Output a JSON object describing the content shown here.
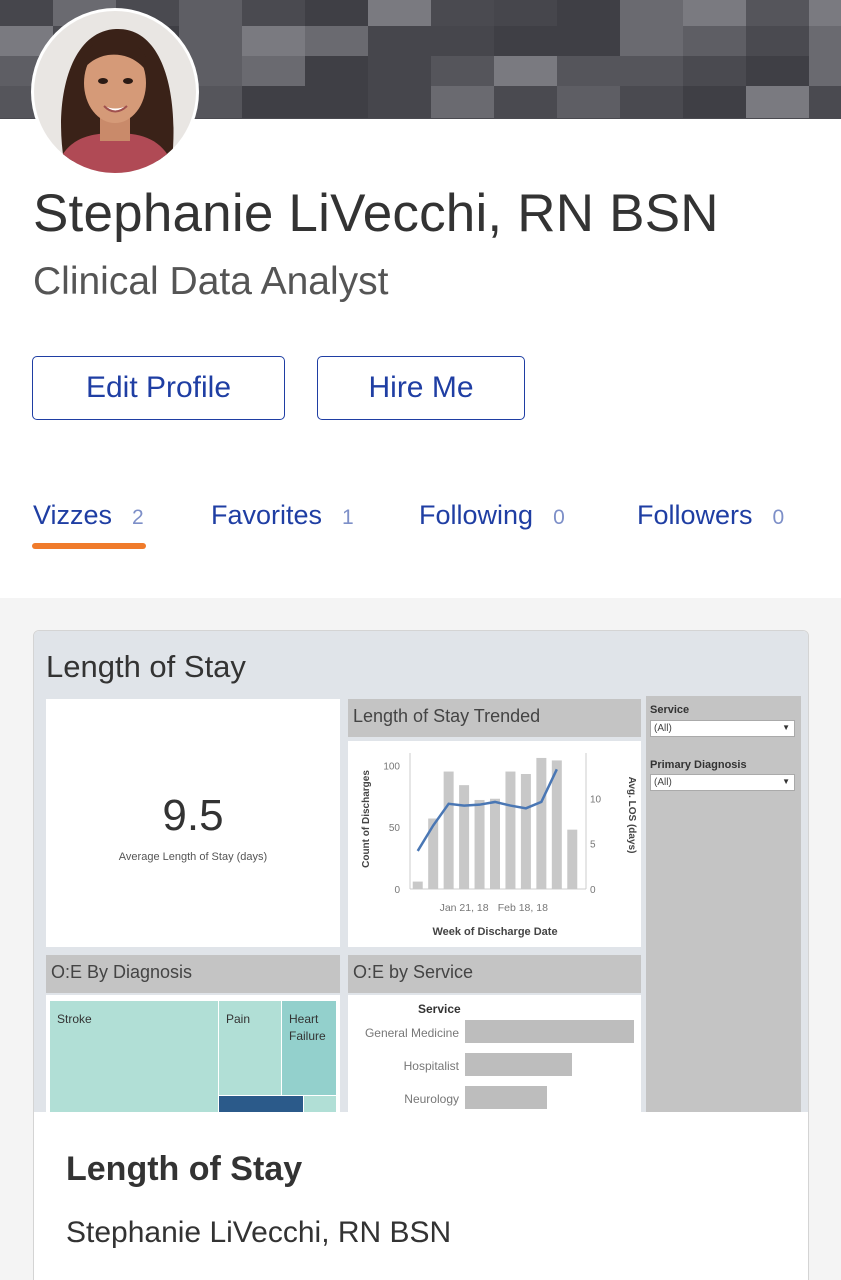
{
  "profile": {
    "name": "Stephanie LiVecchi, RN BSN",
    "title": "Clinical Data Analyst"
  },
  "actions": {
    "edit_profile": "Edit Profile",
    "hire_me": "Hire Me"
  },
  "tabs": [
    {
      "label": "Vizzes",
      "count": "2",
      "active": true
    },
    {
      "label": "Favorites",
      "count": "1",
      "active": false
    },
    {
      "label": "Following",
      "count": "0",
      "active": false
    },
    {
      "label": "Followers",
      "count": "0",
      "active": false
    }
  ],
  "colors": {
    "brand_blue": "#1f3ea3",
    "active_tab_underline": "#f07b2b",
    "treemap_teal": "#b1dfd6",
    "treemap_dark_blue": "#2b5a8a",
    "trend_line": "#4a77b4",
    "bar_gray": "#c8c8c8"
  },
  "viz": {
    "dashboard_title": "Length of Stay",
    "kpi": {
      "value": "9.5",
      "label": "Average Length of Stay (days)"
    },
    "trend": {
      "title": "Length of Stay Trended",
      "y_left_label": "Count of Discharges",
      "y_right_label": "Avg. LOS (days)",
      "x_label": "Week of Discharge Date",
      "x_ticks": [
        "Jan 21, 18",
        "Feb 18, 18"
      ],
      "y_left_ticks": [
        "100",
        "50",
        "0"
      ],
      "y_right_ticks": [
        "10",
        "5",
        "0"
      ]
    },
    "filters": {
      "service_label": "Service",
      "service_value": "(All)",
      "diagnosis_label": "Primary Diagnosis",
      "diagnosis_value": "(All)"
    },
    "oe_diagnosis": {
      "title": "O:E By Diagnosis",
      "cells": [
        "Stroke",
        "Pain",
        "Heart Failure"
      ]
    },
    "oe_service": {
      "title": "O:E by Service",
      "header": "Service",
      "rows": [
        "General Medicine",
        "Hospitalist",
        "Neurology"
      ]
    },
    "card_title": "Length of Stay",
    "card_author": "Stephanie LiVecchi, RN BSN"
  },
  "chart_data": {
    "type": "bar",
    "x": [
      "w1",
      "w2",
      "w3",
      "w4",
      "w5",
      "w6",
      "w7",
      "w8",
      "w9",
      "w10",
      "w11"
    ],
    "x_tick_labels": [
      "Jan 21, 18",
      "Feb 18, 18"
    ],
    "series": [
      {
        "name": "Count of Discharges",
        "kind": "bar",
        "axis": "left",
        "values": [
          6,
          57,
          95,
          84,
          72,
          73,
          95,
          93,
          106,
          104,
          48
        ]
      },
      {
        "name": "Avg. LOS (days)",
        "kind": "line",
        "axis": "right",
        "values": [
          4.2,
          7.0,
          9.4,
          9.2,
          9.3,
          9.6,
          9.2,
          8.9,
          9.6,
          13.2
        ]
      }
    ],
    "title": "Length of Stay Trended",
    "xlabel": "Week of Discharge Date",
    "ylabel": "Count of Discharges",
    "y2label": "Avg. LOS (days)",
    "ylim": [
      0,
      110
    ],
    "y2lim": [
      0,
      15
    ]
  }
}
